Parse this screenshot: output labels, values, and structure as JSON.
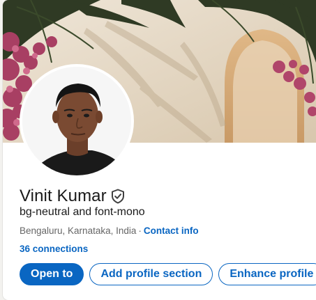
{
  "profile": {
    "name": "Vinit Kumar",
    "headline": "bg-neutral and font-mono",
    "location": "Bengaluru, Karnataka, India",
    "separator": "·",
    "contact_info_label": "Contact info",
    "connections_label": "36 connections",
    "verified_icon": "shield-check-icon"
  },
  "actions": {
    "open_to_label": "Open to",
    "add_section_label": "Add profile section",
    "enhance_label": "Enhance profile"
  },
  "colors": {
    "accent": "#0a66c2",
    "text_primary": "#191919",
    "text_secondary": "#666666",
    "background": "#f3f2ef"
  }
}
